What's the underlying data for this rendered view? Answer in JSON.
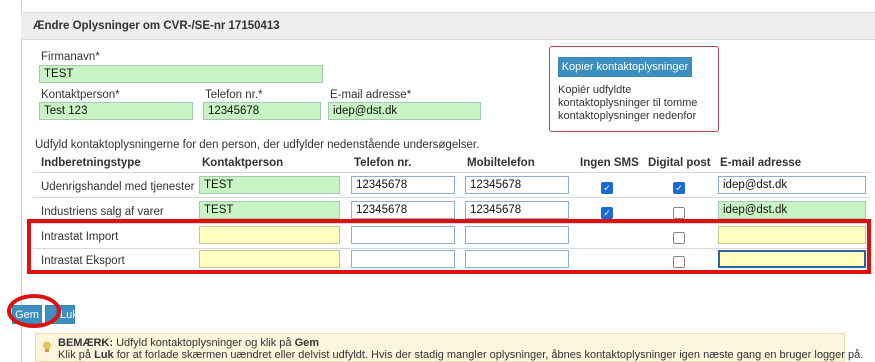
{
  "header": {
    "title": "Ændre Oplysninger om CVR-/SE-nr 17150413"
  },
  "company": {
    "firmanavn_label": "Firmanavn*",
    "firmanavn_value": "TEST",
    "kontaktperson_label": "Kontaktperson*",
    "kontaktperson_value": "Test 123",
    "telefon_label": "Telefon nr.*",
    "telefon_value": "12345678",
    "email_label": "E-mail adresse*",
    "email_value": "idep@dst.dk"
  },
  "copy_box": {
    "button_label": "Kopier kontaktoplysninger",
    "description": "Kopiér udfyldte kontaktoplysninger til tomme kontaktoplysninger nedenfor"
  },
  "instruction": "Udfyld kontaktoplysningerne for den person, der udfylder nedenstående undersøgelser.",
  "table": {
    "headers": [
      "Indberetningstype",
      "Kontaktperson",
      "Telefon nr.",
      "Mobiltelefon",
      "Ingen SMS",
      "Digital post",
      "E-mail adresse"
    ],
    "rows": [
      {
        "type": "Udenrigshandel med tjenester",
        "kontaktperson": "TEST",
        "telefon": "12345678",
        "mobil": "12345678",
        "ingen_sms": true,
        "digital_post": true,
        "email": "idep@dst.dk"
      },
      {
        "type": "Industriens salg af varer",
        "kontaktperson": "TEST",
        "telefon": "12345678",
        "mobil": "12345678",
        "ingen_sms": true,
        "digital_post": false,
        "email": "idep@dst.dk"
      },
      {
        "type": "Intrastat Import",
        "kontaktperson": "",
        "telefon": "",
        "mobil": "",
        "ingen_sms": null,
        "digital_post": false,
        "email": ""
      },
      {
        "type": "Intrastat Eksport",
        "kontaktperson": "",
        "telefon": "",
        "mobil": "",
        "ingen_sms": null,
        "digital_post": false,
        "email": ""
      }
    ]
  },
  "buttons": {
    "gem": "Gem",
    "luk": "Luk"
  },
  "note": {
    "label": "BEMÆRK:",
    "line1_text": "Udfyld kontaktoplysninger og klik på",
    "line1_bold": "Gem",
    "line2_pre": "Klik på",
    "line2_bold": "Luk",
    "line2_text": "for at forlade skærmen uændret eller delvist udfyldt. Hvis der stadig mangler oplysninger, åbnes kontaktoplysninger igen næste gang en bruger logger på."
  },
  "colors": {
    "accent": "#3d8fbf",
    "highlight": "#e01010",
    "filled": "#c8f5c3",
    "empty": "#ffffc0"
  },
  "icons": {
    "note": "lightbulb-icon",
    "check": "checkmark-icon"
  }
}
